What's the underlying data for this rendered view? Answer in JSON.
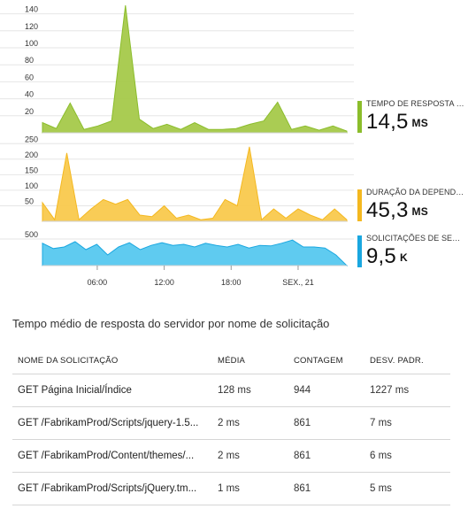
{
  "colors": {
    "response_time": "#a5c94a",
    "dependency": "#f9c94d",
    "requests": "#56c8ef",
    "grid": "#e6e6e6",
    "axis_text": "#333333"
  },
  "legend": [
    {
      "label": "TEMPO DE RESPOSTA DO...",
      "value": "14,5",
      "unit": "MS",
      "color": "#8bbd2b"
    },
    {
      "label": "DURAÇÃO DA DEPENDÊ...",
      "value": "45,3",
      "unit": "MS",
      "color": "#f4b820"
    },
    {
      "label": "SOLICITAÇÕES DE SERVI...",
      "value": "9,5",
      "unit": "K",
      "color": "#1aa7e0"
    }
  ],
  "x_axis": {
    "ticks": [
      {
        "label": "06:00",
        "pos": 0.18
      },
      {
        "label": "12:00",
        "pos": 0.4
      },
      {
        "label": "18:00",
        "pos": 0.62
      },
      {
        "label": "SEX., 21",
        "pos": 0.84
      }
    ]
  },
  "chart_data": [
    {
      "type": "area",
      "name": "TEMPO DE RESPOSTA DO...",
      "ylim": [
        0,
        150
      ],
      "yticks": [
        20,
        40,
        60,
        80,
        100,
        120,
        140
      ],
      "values": [
        12,
        5,
        35,
        4,
        8,
        14,
        150,
        16,
        5,
        10,
        4,
        12,
        4,
        4,
        5,
        10,
        14,
        36,
        4,
        8,
        3,
        8,
        2
      ]
    },
    {
      "type": "area",
      "name": "DURAÇÃO DA DEPENDÊ...",
      "ylim": [
        0,
        265
      ],
      "yticks": [
        50,
        100,
        150,
        200,
        250
      ],
      "values": [
        60,
        5,
        220,
        5,
        40,
        70,
        55,
        70,
        20,
        15,
        50,
        10,
        20,
        5,
        10,
        70,
        50,
        240,
        5,
        40,
        10,
        40,
        20,
        5,
        40,
        5
      ]
    },
    {
      "type": "area",
      "name": "SOLICITAÇÕES DE SERVI...",
      "ylim": [
        0,
        700
      ],
      "yticks": [
        500
      ],
      "values": [
        420,
        320,
        350,
        450,
        300,
        400,
        200,
        350,
        430,
        300,
        380,
        430,
        380,
        400,
        350,
        420,
        380,
        350,
        400,
        330,
        380,
        370,
        420,
        480,
        350,
        350,
        330,
        200,
        0
      ]
    }
  ],
  "table": {
    "title": "Tempo médio de resposta do servidor por nome de solicitação",
    "headers": [
      "NOME DA SOLICITAÇÃO",
      "MÉDIA",
      "CONTAGEM",
      "DESV. PADR."
    ],
    "rows": [
      [
        "GET Página Inicial/Índice",
        "128 ms",
        "944",
        "1227 ms"
      ],
      [
        "GET /FabrikamProd/Scripts/jquery-1.5...",
        "2 ms",
        "861",
        "7 ms"
      ],
      [
        "GET /FabrikamProd/Content/themes/...",
        "2 ms",
        "861",
        "6 ms"
      ],
      [
        "GET /FabrikamProd/Scripts/jQuery.tm...",
        "1 ms",
        "861",
        "5 ms"
      ]
    ]
  }
}
